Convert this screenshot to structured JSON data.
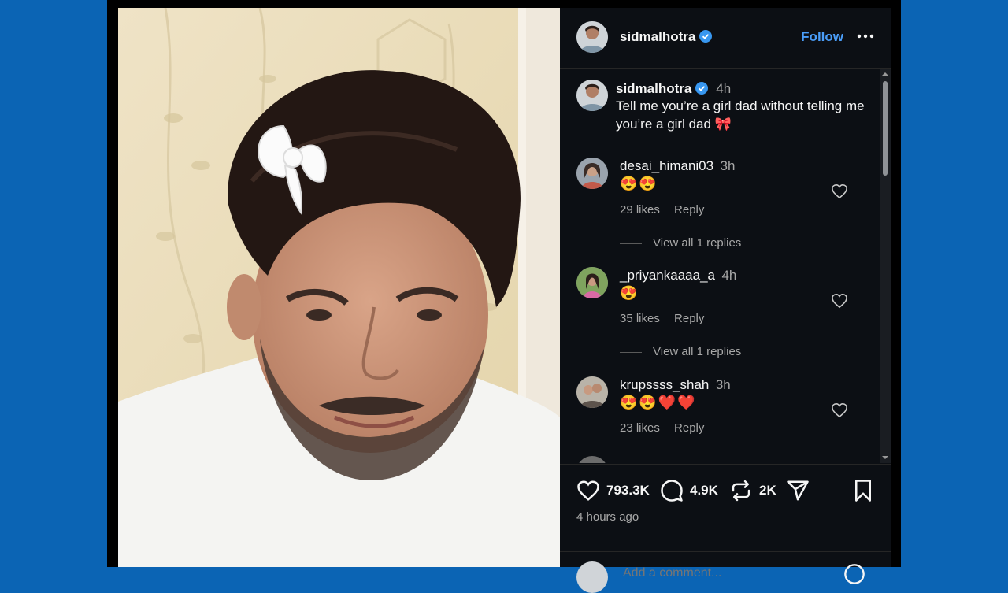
{
  "post": {
    "username": "sidmalhotra",
    "follow_label": "Follow",
    "caption_time": "4h",
    "caption": "Tell me you’re a girl dad without telling me you’re a girl dad",
    "caption_emoji": "🎀",
    "likes_count": "793.3K",
    "comments_count": "4.9K",
    "reposts_count": "2K",
    "posted_ago": "4 hours ago",
    "add_comment_placeholder": "Add a comment..."
  },
  "comments": [
    {
      "username": "desai_himani03",
      "time": "3h",
      "text": "😍😍",
      "likes": "29 likes",
      "reply": "Reply",
      "view_replies": "View all 1 replies"
    },
    {
      "username": "_priyankaaaa_a",
      "time": "4h",
      "text": "😍",
      "likes": "35 likes",
      "reply": "Reply",
      "view_replies": "View all 1 replies"
    },
    {
      "username": "krupssss_shah",
      "time": "3h",
      "text": "😍😍❤️❤️",
      "likes": "23 likes",
      "reply": "Reply"
    }
  ],
  "colors": {
    "page_background": "#0b64b4",
    "panel_background": "#0c0f14",
    "accent_blue": "#4a9df8",
    "text_secondary": "#a8a8a8"
  },
  "icons": [
    "verified-badge-icon",
    "more-options-icon",
    "heart-icon",
    "comment-icon",
    "repost-icon",
    "share-icon",
    "bookmark-icon"
  ]
}
